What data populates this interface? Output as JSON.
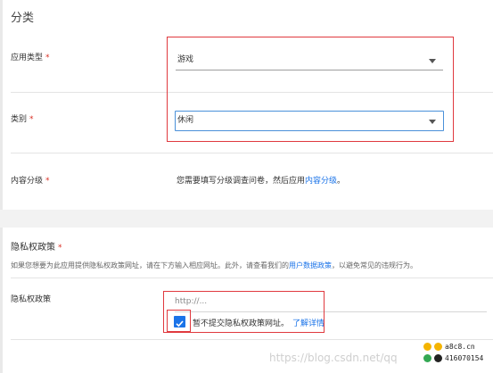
{
  "category": {
    "title": "分类",
    "app_type": {
      "label": "应用类型",
      "value": "游戏"
    },
    "category": {
      "label": "类别",
      "value": "休闲"
    },
    "content_rating": {
      "label": "内容分级",
      "text": "您需要填写分级调查问卷，然后应用",
      "link": "内容分级",
      "suffix": "。"
    }
  },
  "privacy": {
    "title": "隐私权政策",
    "description": "如果您想要为此应用提供隐私权政策网址，请在下方输入相应网址。此外，请查看我们的",
    "desc_link": "用户数据政策",
    "desc_suffix": "，以避免常见的违规行为。",
    "field_label": "隐私权政策",
    "url_placeholder": "http://...",
    "checkbox_label": "暂不提交隐私权政策网址。",
    "learn_more": "了解详情"
  },
  "required_mark": "*",
  "watermark": "https://blog.csdn.net/qq",
  "site_badge": {
    "site": "a8c8.cn",
    "qq": "416070154"
  },
  "colors": {
    "accent": "#1a73e8",
    "highlight": "#e0393e",
    "required": "#d93025"
  }
}
